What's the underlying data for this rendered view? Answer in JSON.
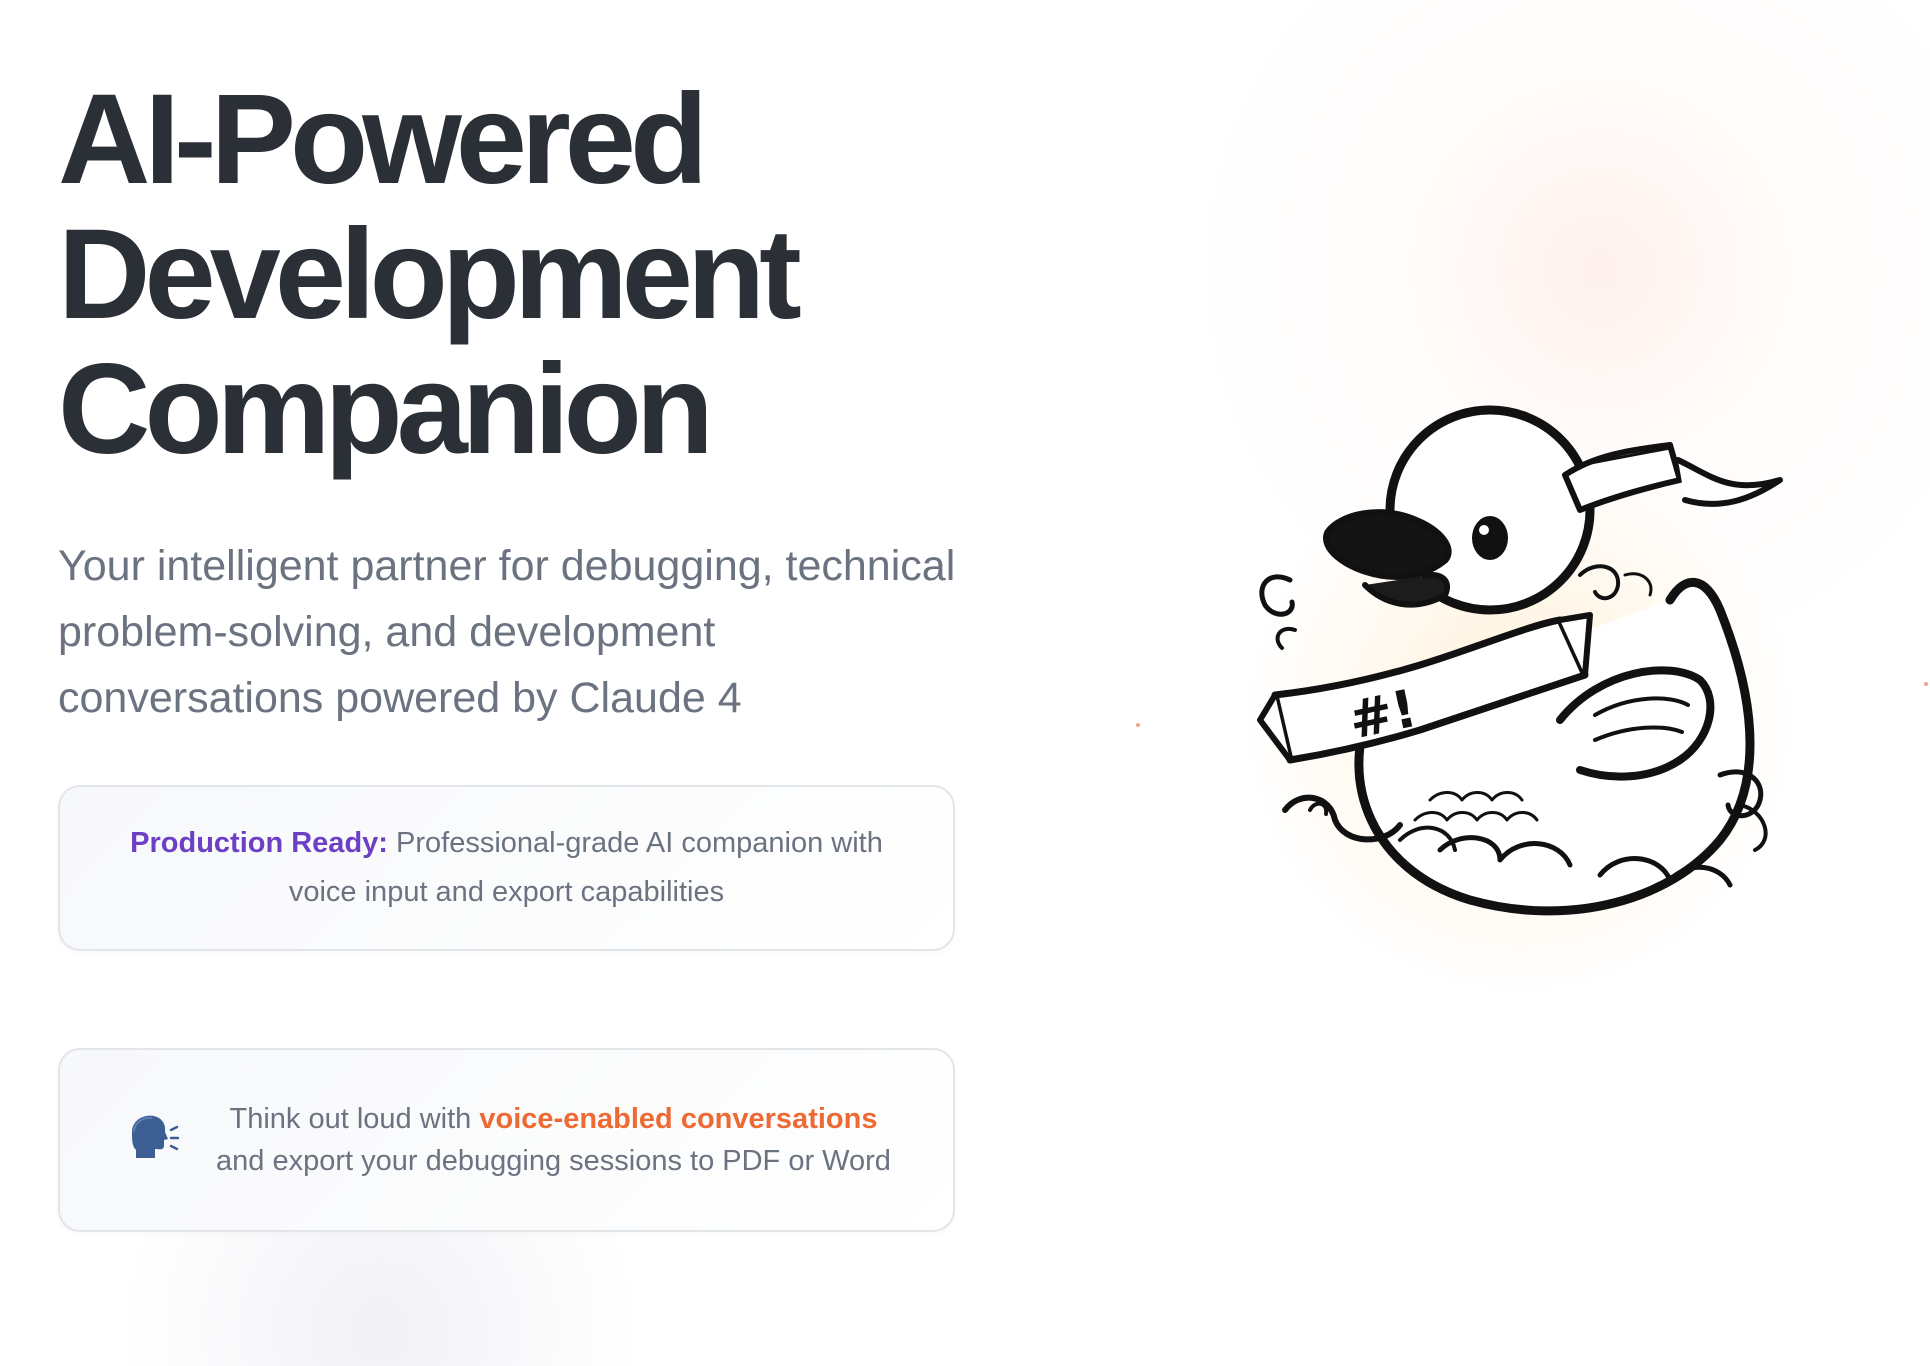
{
  "hero": {
    "title_lines": [
      "AI-Powered",
      "Development",
      "Companion"
    ],
    "subtitle": "Your intelligent partner for debugging, technical problem-solving, and development conversations powered by Claude 4"
  },
  "feature_card": {
    "label": "Production Ready:",
    "text": " Professional-grade AI companion with voice input and export capabilities"
  },
  "voice_card": {
    "icon": "speaking-head-icon",
    "text_before": "Think out loud with ",
    "highlight": "voice-enabled conversations",
    "text_after": "and export your debugging sessions to PDF or Word"
  },
  "illustration": {
    "icon": "rubber-duck-logo",
    "banner_text": "#!"
  },
  "colors": {
    "headline": "#2b2f36",
    "body": "#6b7280",
    "accent_purple": "#6d3fc4",
    "accent_orange": "#ee6a34",
    "card_border": "#e2e5ea"
  }
}
